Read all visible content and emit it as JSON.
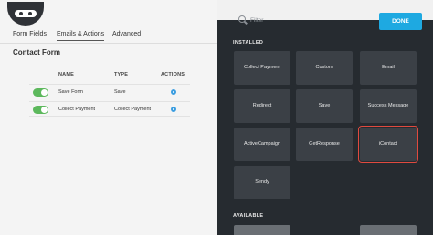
{
  "tabs": [
    {
      "label": "Form Fields"
    },
    {
      "label": "Emails & Actions",
      "active": true
    },
    {
      "label": "Advanced"
    }
  ],
  "form": {
    "title": "Contact Form"
  },
  "table": {
    "headers": {
      "name": "NAME",
      "type": "TYPE",
      "actions": "ACTIONS"
    },
    "rows": [
      {
        "name": "Save Form",
        "type": "Save",
        "enabled": true
      },
      {
        "name": "Collect Payment",
        "type": "Collect Payment",
        "enabled": true
      }
    ]
  },
  "drawer": {
    "search_placeholder": "Filter",
    "done_label": "DONE",
    "installed_label": "INSTALLED",
    "available_label": "AVAILABLE",
    "tiles": [
      {
        "label": "Collect Payment"
      },
      {
        "label": "Custom"
      },
      {
        "label": "Email"
      },
      {
        "label": "Redirect"
      },
      {
        "label": "Save"
      },
      {
        "label": "Success Message"
      },
      {
        "label": "ActiveCampaign"
      },
      {
        "label": "GetResponse"
      },
      {
        "label": "iContact",
        "selected": true
      },
      {
        "label": "Sendy"
      }
    ]
  },
  "colors": {
    "accent": "#1ea9e1",
    "toggle_on": "#5cb85c",
    "drawer_bg": "#262b30",
    "tile_bg": "#3b4046",
    "selection": "#e04a3f"
  },
  "icons": {
    "logo": "ninja-logo-icon",
    "search": "search-icon",
    "row_action": "gear-icon"
  }
}
